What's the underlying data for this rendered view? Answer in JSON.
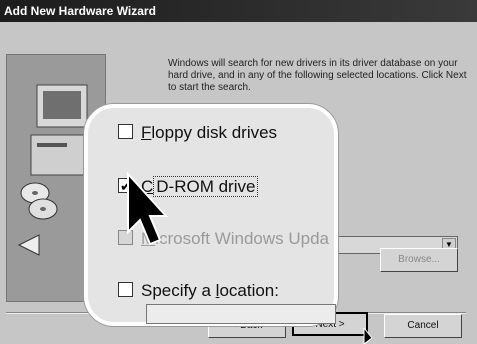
{
  "window": {
    "title": "Add New Hardware Wizard"
  },
  "description": "Windows will search for new drivers in its driver database on your hard drive, and in any of the following selected locations. Click Next to start the search.",
  "options": [
    {
      "label_pre": "",
      "label_key": "F",
      "label_post": "loppy disk drives",
      "checked": false,
      "enabled": true
    },
    {
      "label_pre": "",
      "label_key": "C",
      "label_post": "D-ROM drive",
      "checked": true,
      "enabled": true
    },
    {
      "label_pre": "",
      "label_key": "M",
      "label_post": "icrosoft Windows Upda",
      "checked": false,
      "enabled": false
    },
    {
      "label_pre": "Specify a ",
      "label_key": "l",
      "label_post": "ocation:",
      "checked": false,
      "enabled": true
    }
  ],
  "buttons": {
    "browse": "Browse...",
    "back": "< Back",
    "next": "Next >",
    "cancel": "Cancel"
  },
  "icons": {
    "computer": "computer-illustration-icon",
    "cd": "cd-discs-icon",
    "pointer": "mouse-pointer-icon"
  }
}
